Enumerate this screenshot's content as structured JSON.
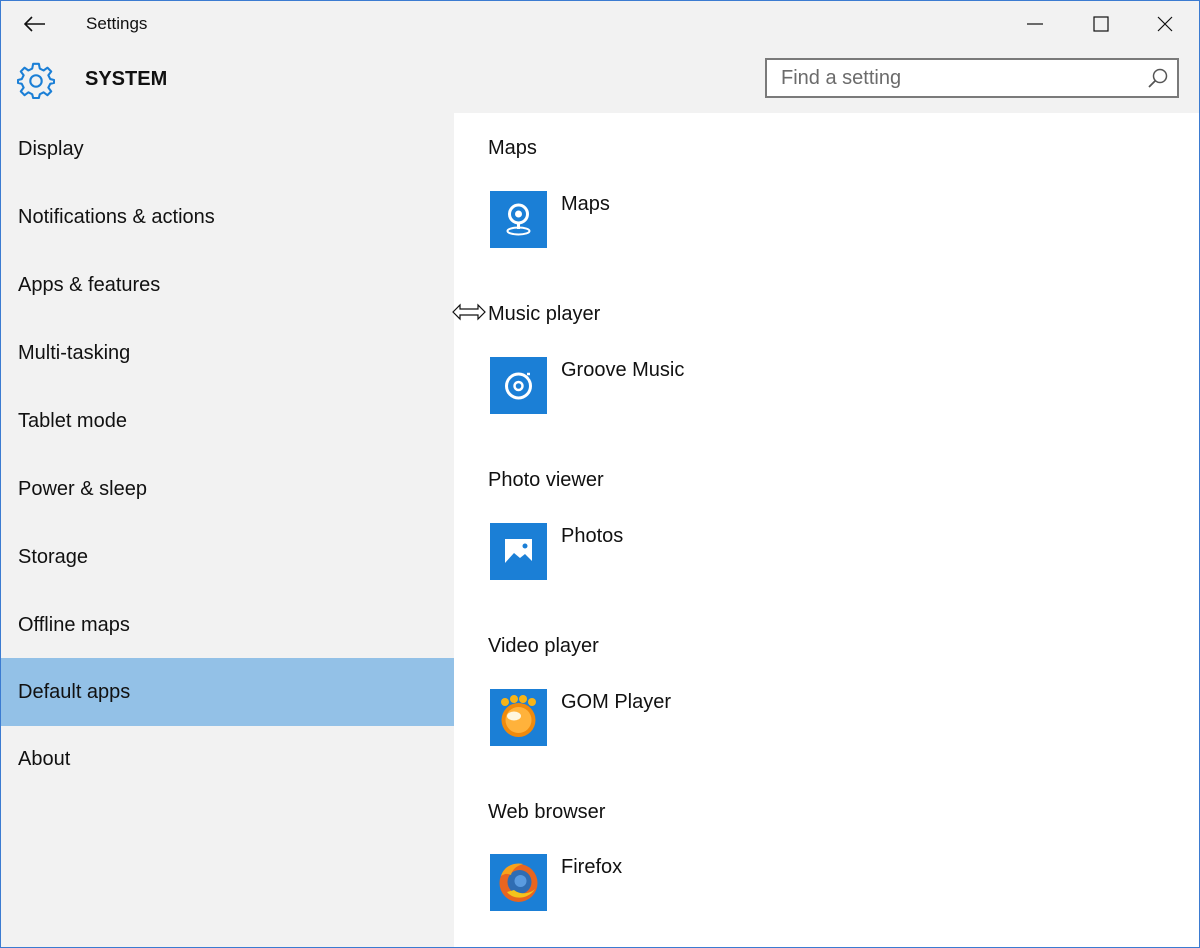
{
  "window": {
    "title": "Settings",
    "controls": {
      "minimize": "minimize-icon",
      "maximize": "maximize-icon",
      "close": "close-icon"
    }
  },
  "header": {
    "icon": "gear-icon",
    "title": "SYSTEM",
    "search_placeholder": "Find a setting"
  },
  "sidebar": {
    "items": [
      {
        "label": "Display"
      },
      {
        "label": "Notifications & actions"
      },
      {
        "label": "Apps & features"
      },
      {
        "label": "Multi-tasking"
      },
      {
        "label": "Tablet mode"
      },
      {
        "label": "Power & sleep"
      },
      {
        "label": "Storage"
      },
      {
        "label": "Offline maps"
      },
      {
        "label": "Default apps",
        "selected": true
      },
      {
        "label": "About"
      }
    ]
  },
  "main": {
    "groups": [
      {
        "label": "Maps",
        "app": "Maps",
        "icon": "maps-app-icon"
      },
      {
        "label": "Music player",
        "app": "Groove Music",
        "icon": "groove-music-icon"
      },
      {
        "label": "Photo viewer",
        "app": "Photos",
        "icon": "photos-app-icon"
      },
      {
        "label": "Video player",
        "app": "GOM Player",
        "icon": "gom-player-icon"
      },
      {
        "label": "Web browser",
        "app": "Firefox",
        "icon": "firefox-icon"
      }
    ]
  },
  "colors": {
    "accent": "#1b7fd6",
    "selected_nav": "#93c1e7",
    "chrome_bg": "#f2f2f2"
  }
}
